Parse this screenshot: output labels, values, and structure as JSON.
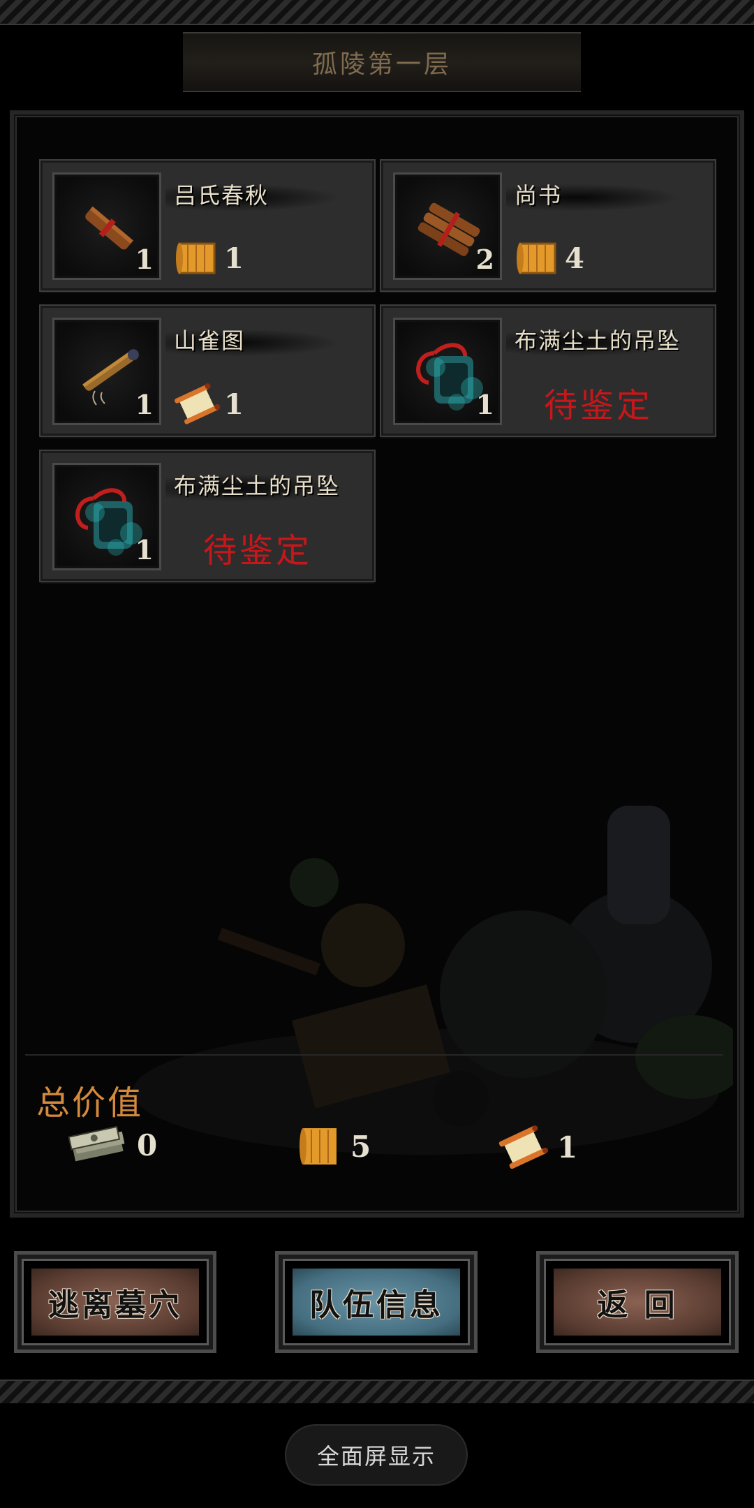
{
  "header": {
    "title": "孤陵第一层"
  },
  "items": [
    {
      "name": "吕氏春秋",
      "count": "1",
      "value": "1",
      "value_icon": "gold-scroll-icon",
      "icon": "bamboo-scroll-red-icon"
    },
    {
      "name": "尚书",
      "count": "2",
      "value": "4",
      "value_icon": "gold-scroll-icon",
      "icon": "bamboo-bundle-icon"
    },
    {
      "name": "山雀图",
      "count": "1",
      "value": "1",
      "value_icon": "paper-scroll-icon",
      "icon": "painting-scroll-icon"
    },
    {
      "name": "布满尘土的吊坠",
      "count": "1",
      "status": "待鉴定",
      "icon": "dusty-pendant-icon"
    },
    {
      "name": "布满尘土的吊坠",
      "count": "1",
      "status": "待鉴定",
      "icon": "dusty-pendant-icon"
    }
  ],
  "totals": {
    "label": "总价值",
    "money": "0",
    "gold_scroll": "5",
    "paper_scroll": "1"
  },
  "buttons": {
    "escape": "逃离墓穴",
    "team_info": "队伍信息",
    "back": "返 回"
  },
  "fullscreen_label": "全面屏显示",
  "colors": {
    "pending": "#c8171a",
    "total_label": "#d38a3d",
    "button_brown": "#7a5444",
    "button_blue": "#5c8798"
  }
}
